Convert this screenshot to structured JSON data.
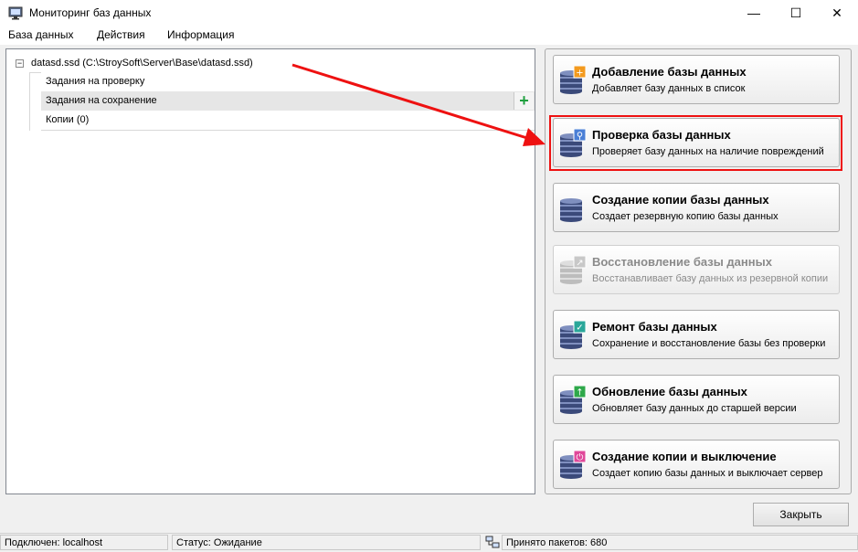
{
  "window": {
    "title": "Мониторинг баз данных",
    "min_icon": "—",
    "max_icon": "☐",
    "close_icon": "✕"
  },
  "menu": [
    "База данных",
    "Действия",
    "Информация"
  ],
  "tree": {
    "expander": "−",
    "root": "datasd.ssd (C:\\StroySoft\\Server\\Base\\datasd.ssd)",
    "children": [
      "Задания на проверку",
      "Задания на сохранение",
      "Копии (0)"
    ],
    "add_icon": "+"
  },
  "actions": [
    {
      "title": "Добавление базы данных",
      "desc": "Добавляет базу данных в список",
      "badge": "#f39a1e",
      "glyph": "+",
      "enabled": true
    },
    {
      "title": "Проверка базы данных",
      "desc": "Проверяет базу данных на наличие повреждений",
      "badge": "#4a7fd6",
      "glyph": "⚲",
      "enabled": true
    },
    {
      "title": "Создание копии базы данных",
      "desc": "Создает резервную копию базы данных",
      "badge": "",
      "glyph": "",
      "enabled": true
    },
    {
      "title": "Восстановление базы данных",
      "desc": "Восстанавливает базу данных из резервной копии",
      "badge": "#c8c8c8",
      "glyph": "↗",
      "enabled": false
    },
    {
      "title": "Ремонт базы данных",
      "desc": "Сохранение и восстановление базы без проверки",
      "badge": "#2aa79a",
      "glyph": "✓",
      "enabled": true
    },
    {
      "title": "Обновление базы данных",
      "desc": "Обновляет базу данных до старшей версии",
      "badge": "#2ea84a",
      "glyph": "↑",
      "enabled": true
    },
    {
      "title": "Создание копии и выключение",
      "desc": "Создает копию базы данных и выключает сервер",
      "badge": "#e0489a",
      "glyph": "⏻",
      "enabled": true
    }
  ],
  "close_button": "Закрыть",
  "status": {
    "connected": "Подключен: localhost",
    "state": "Статус: Ожидание",
    "packets": "Принято пакетов: 680"
  }
}
